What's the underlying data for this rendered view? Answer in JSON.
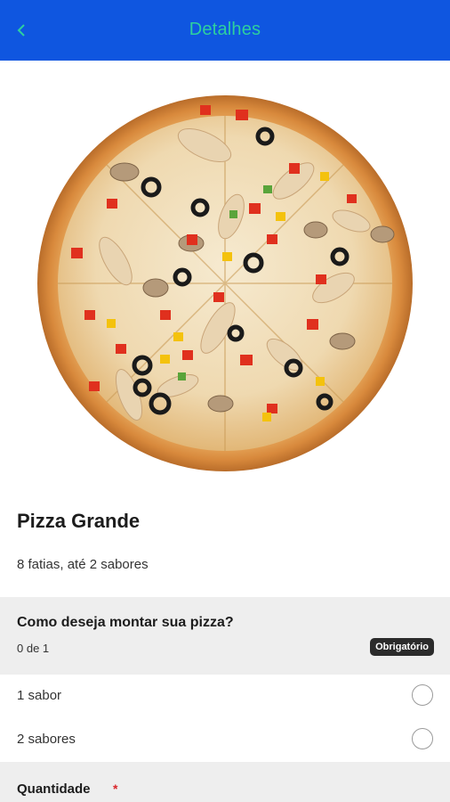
{
  "header": {
    "back_icon": "chevron-left-icon",
    "title": "Detalhes",
    "background": "#0f56e0",
    "title_color": "#2ecf9f"
  },
  "product": {
    "image": "pizza-photo",
    "name": "Pizza Grande",
    "description": "8 fatias, até 2 sabores"
  },
  "options_section": {
    "title": "Como deseja montar sua pizza?",
    "count": "0 de 1",
    "badge": "Obrigatório",
    "items": [
      {
        "label": "1 sabor",
        "selected": false
      },
      {
        "label": "2 sabores",
        "selected": false
      }
    ]
  },
  "quantity_section": {
    "label": "Quantidade",
    "required_mark": "*"
  }
}
